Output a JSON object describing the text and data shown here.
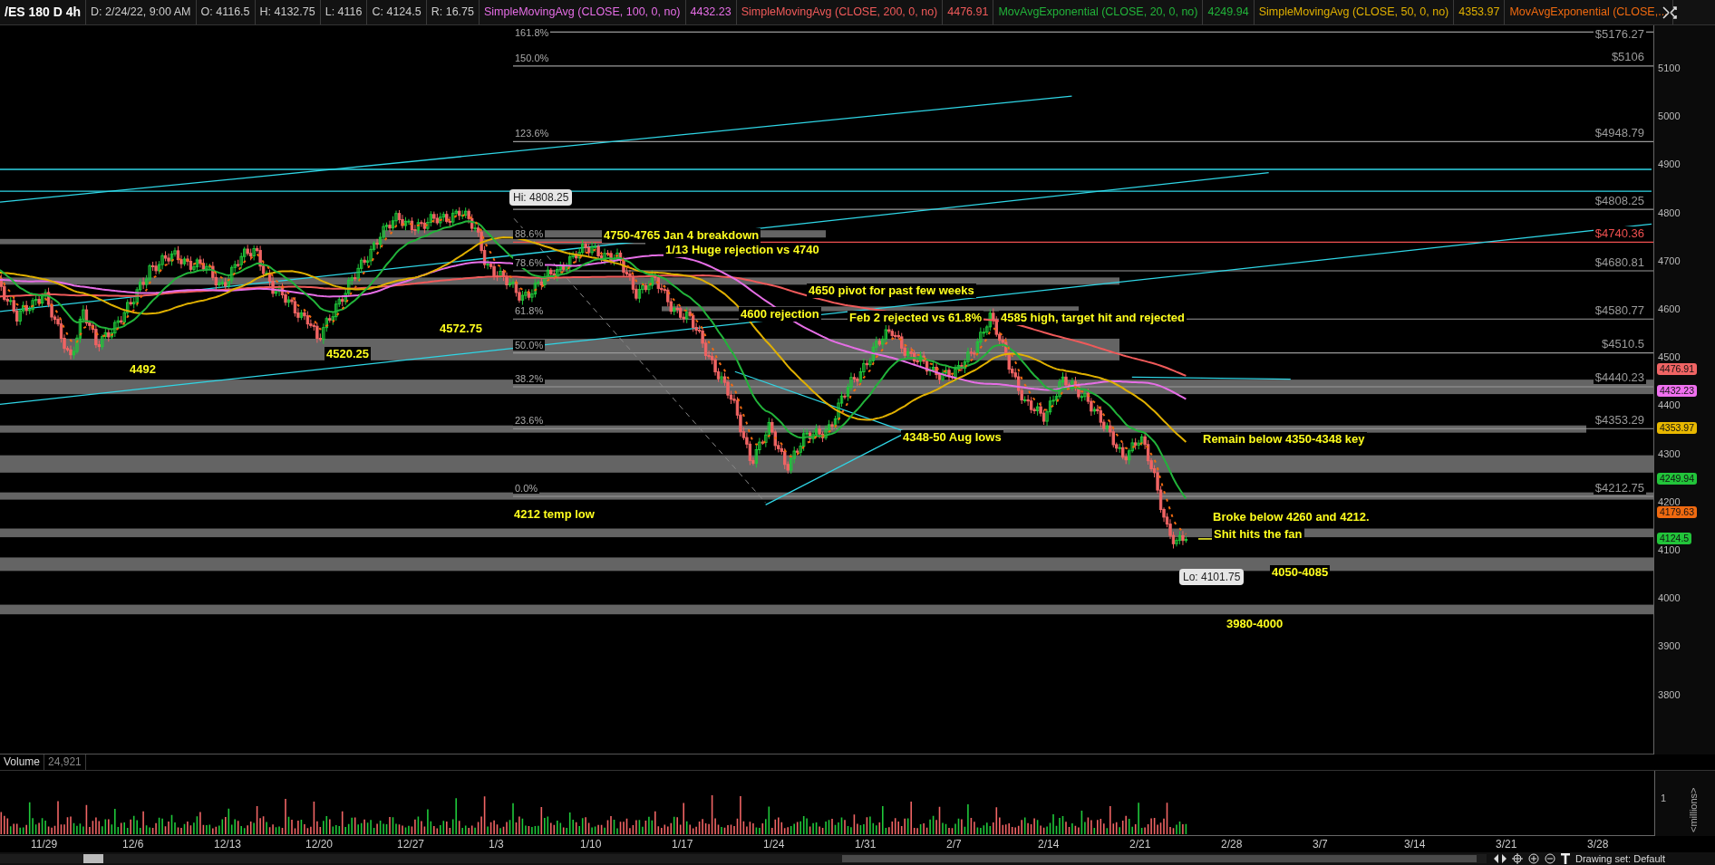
{
  "header": {
    "symbol": "/ES 180 D 4h",
    "fields": [
      "D: 2/24/22, 9:00 AM",
      "O: 4116.5",
      "H: 4132.75",
      "L: 4116",
      "C: 4124.5",
      "R: 16.75"
    ],
    "studies": [
      {
        "name": "SimpleMovingAvg (CLOSE, 100, 0, no)",
        "value": "4432.23",
        "color": "#e66ee6"
      },
      {
        "name": "SimpleMovingAvg (CLOSE, 200, 0, no)",
        "value": "4476.91",
        "color": "#f05a5a"
      },
      {
        "name": "MovAvgExponential (CLOSE, 20, 0, no)",
        "value": "4249.94",
        "color": "#22b33a"
      },
      {
        "name": "SimpleMovingAvg (CLOSE, 50, 0, no)",
        "value": "4353.97",
        "color": "#e0b000"
      },
      {
        "name": "MovAvgExponential (CLOSE,...",
        "color": "#f06a10"
      }
    ]
  },
  "fib_levels": [
    {
      "pct": "161.8%",
      "price": "$5176.27",
      "color": "#9a9a9a"
    },
    {
      "pct": "150.0%",
      "price": "$5106",
      "color": "#9a9a9a"
    },
    {
      "pct": "123.6%",
      "price": "$4948.79",
      "color": "#9a9a9a"
    },
    {
      "price": "$4808.25",
      "color": "#9a9a9a"
    },
    {
      "pct": "88.6%",
      "price": "$4740.36",
      "color": "#f05050"
    },
    {
      "pct": "78.6%",
      "price": "$4680.81",
      "color": "#9a9a9a"
    },
    {
      "pct": "61.8%",
      "price": "$4580.77",
      "color": "#9a9a9a"
    },
    {
      "pct": "50.0%",
      "price": "$4510.5",
      "color": "#9a9a9a"
    },
    {
      "pct": "38.2%",
      "price": "$4440.23",
      "color": "#9a9a9a"
    },
    {
      "pct": "23.6%",
      "price": "$4353.29",
      "color": "#9a9a9a"
    },
    {
      "pct": "0.0%",
      "price": "$4212.75",
      "color": "#9a9a9a"
    }
  ],
  "annotations": [
    "4750-4765 Jan 4 breakdown",
    "1/13 Huge rejection vs 4740",
    "4650 pivot for past few weeks",
    "4600 rejection",
    "Feb 2 rejected vs 61.8%",
    "4585 high, target hit and rejected",
    "4572.75",
    "4520.25",
    "4492",
    "4348-50 Aug lows",
    "Remain below 4350-4348 key",
    "4212 temp low",
    "Broke below 4260 and 4212.",
    "Shit hits the fan",
    "4050-4085",
    "3980-4000"
  ],
  "callouts": {
    "high": "Hi: 4808.25",
    "low": "Lo: 4101.75"
  },
  "price_axis": [
    "5100",
    "5000",
    "4900",
    "4800",
    "4700",
    "4600",
    "4500",
    "4400",
    "4300",
    "4200",
    "4100",
    "4000",
    "3900",
    "3800"
  ],
  "price_badges": [
    {
      "value": "4476.91",
      "color": "#f06464"
    },
    {
      "value": "4432.23",
      "color": "#f070f0"
    },
    {
      "value": "4353.97",
      "color": "#e8b800"
    },
    {
      "value": "4249.94",
      "color": "#22c43a"
    },
    {
      "value": "4179.63",
      "color": "#f06a10"
    },
    {
      "value": "4124.5",
      "color": "#22c43a"
    }
  ],
  "volume": {
    "title": "Volume",
    "value": "24,921",
    "axis_label": "1",
    "unit": "<millions>"
  },
  "dates": [
    "11/29",
    "12/6",
    "12/13",
    "12/20",
    "12/27",
    "1/3",
    "1/10",
    "1/17",
    "1/24",
    "1/31",
    "2/7",
    "2/14",
    "2/21",
    "2/28",
    "3/7",
    "3/14",
    "3/21",
    "3/28"
  ],
  "status": {
    "drawing_set": "Drawing set: Default"
  }
}
